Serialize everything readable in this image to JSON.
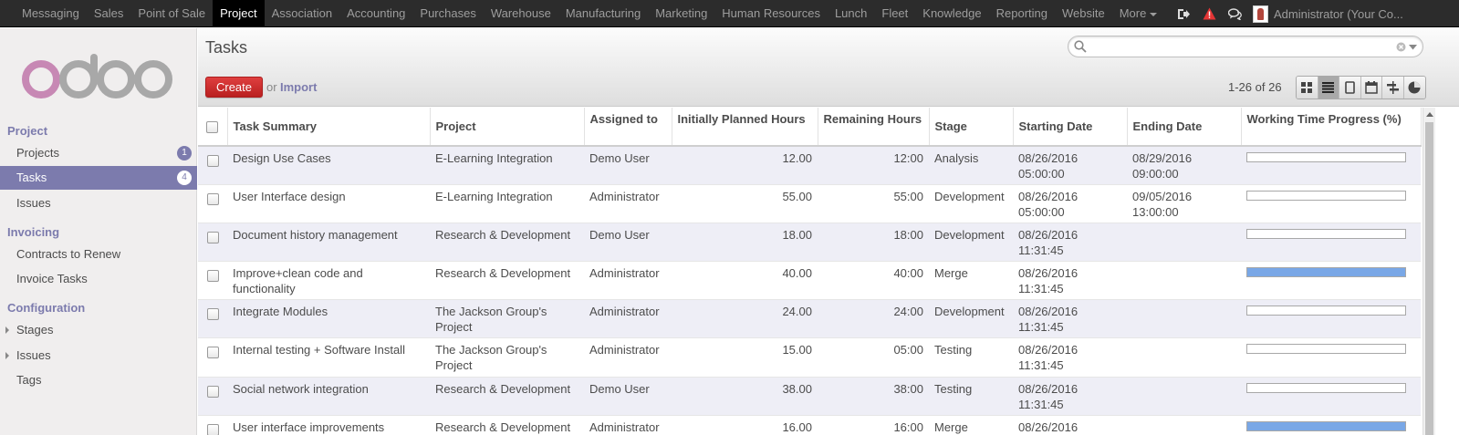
{
  "topbar": {
    "menu": [
      "Messaging",
      "Sales",
      "Point of Sale",
      "Project",
      "Association",
      "Accounting",
      "Purchases",
      "Warehouse",
      "Manufacturing",
      "Marketing",
      "Human Resources",
      "Lunch",
      "Fleet",
      "Knowledge",
      "Reporting",
      "Website",
      "More"
    ],
    "active": "Project",
    "user": "Administrator (Your Co..."
  },
  "sidebar": {
    "logo": "odoo",
    "sections": [
      {
        "label": "Project",
        "items": [
          {
            "label": "Projects",
            "badge": "1"
          },
          {
            "label": "Tasks",
            "badge": "4",
            "active": true
          },
          {
            "label": "Issues"
          }
        ]
      },
      {
        "label": "Invoicing",
        "items": [
          {
            "label": "Contracts to Renew"
          },
          {
            "label": "Invoice Tasks"
          }
        ]
      },
      {
        "label": "Configuration",
        "items": [
          {
            "label": "Stages",
            "expandable": true
          },
          {
            "label": "Issues",
            "expandable": true
          },
          {
            "label": "Tags"
          }
        ]
      }
    ]
  },
  "control_panel": {
    "title": "Tasks",
    "search_value": "",
    "create_label": "Create",
    "or_label": "or",
    "import_label": "Import",
    "pager": "1-26 of 26",
    "views": [
      "kanban",
      "list",
      "form",
      "calendar",
      "gantt",
      "graph"
    ],
    "active_view": "list"
  },
  "table": {
    "columns": [
      "Task Summary",
      "Project",
      "Assigned to",
      "Initially Planned Hours",
      "Remaining Hours",
      "Stage",
      "Starting Date",
      "Ending Date",
      "Working Time Progress (%)"
    ],
    "rows": [
      {
        "summary": "Design Use Cases",
        "project": "E-Learning Integration",
        "assigned": "Demo User",
        "planned": "12.00",
        "remaining": "12:00",
        "stage": "Analysis",
        "start": "08/26/2016 05:00:00",
        "end": "08/29/2016 09:00:00",
        "progress": 0
      },
      {
        "summary": "User Interface design",
        "project": "E-Learning Integration",
        "assigned": "Administrator",
        "planned": "55.00",
        "remaining": "55:00",
        "stage": "Development",
        "start": "08/26/2016 05:00:00",
        "end": "09/05/2016 13:00:00",
        "progress": 0
      },
      {
        "summary": "Document history management",
        "project": "Research & Development",
        "assigned": "Demo User",
        "planned": "18.00",
        "remaining": "18:00",
        "stage": "Development",
        "start": "08/26/2016 11:31:45",
        "end": "",
        "progress": 0
      },
      {
        "summary": "Improve+clean code and functionality",
        "project": "Research & Development",
        "assigned": "Administrator",
        "planned": "40.00",
        "remaining": "40:00",
        "stage": "Merge",
        "start": "08/26/2016 11:31:45",
        "end": "",
        "progress": 100
      },
      {
        "summary": "Integrate Modules",
        "project": "The Jackson Group's Project",
        "assigned": "Administrator",
        "planned": "24.00",
        "remaining": "24:00",
        "stage": "Development",
        "start": "08/26/2016 11:31:45",
        "end": "",
        "progress": 0
      },
      {
        "summary": "Internal testing + Software Install",
        "project": "The Jackson Group's Project",
        "assigned": "Administrator",
        "planned": "15.00",
        "remaining": "05:00",
        "stage": "Testing",
        "start": "08/26/2016 11:31:45",
        "end": "",
        "progress": 0
      },
      {
        "summary": "Social network integration",
        "project": "Research & Development",
        "assigned": "Demo User",
        "planned": "38.00",
        "remaining": "38:00",
        "stage": "Testing",
        "start": "08/26/2016 11:31:45",
        "end": "",
        "progress": 0
      },
      {
        "summary": "User interface improvements",
        "project": "Research & Development",
        "assigned": "Administrator",
        "planned": "16.00",
        "remaining": "16:00",
        "stage": "Merge",
        "start": "08/26/2016",
        "end": "",
        "progress": 100
      }
    ]
  },
  "colors": {
    "accent": "#7c7bad",
    "create": "#d02d2d",
    "progress": "#79a7e6"
  }
}
